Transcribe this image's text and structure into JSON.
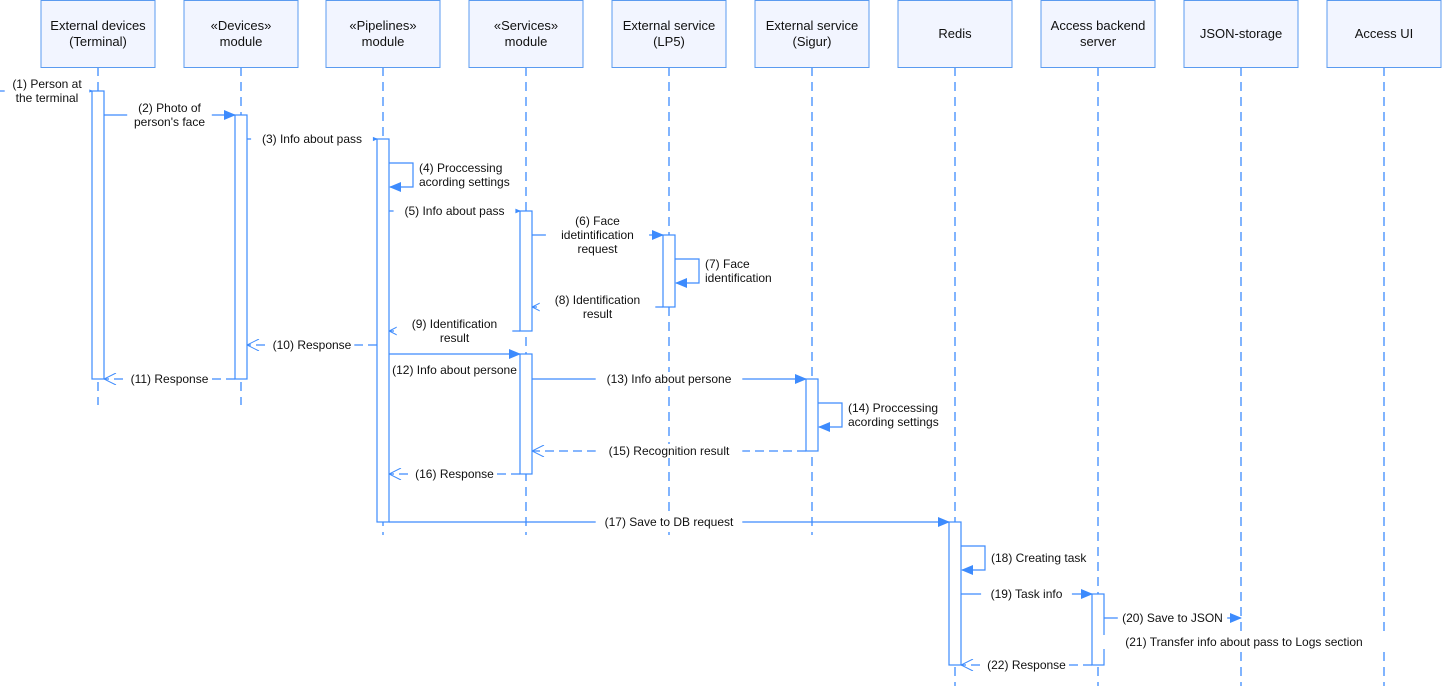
{
  "colors": {
    "line": "#3d8bfd",
    "box_fill": "#f2f5ff",
    "box_stroke": "#5b9bf0",
    "activation_fill": "#ffffff"
  },
  "participants": [
    [
      "External devices",
      "(Terminal)"
    ],
    [
      "«Devices»",
      "module"
    ],
    [
      "«Pipelines»",
      "module"
    ],
    [
      "«Services»",
      "module"
    ],
    [
      "External service",
      "(LP5)"
    ],
    [
      "External service",
      "(Sigur)"
    ],
    [
      "Redis"
    ],
    [
      "Access backend",
      "server"
    ],
    [
      "JSON-storage"
    ],
    [
      "Access UI"
    ]
  ],
  "messages": [
    {
      "from": -1,
      "to": 0,
      "type": "sync",
      "label": [
        "(1) Person at",
        "the terminal"
      ]
    },
    {
      "from": 0,
      "to": 1,
      "type": "sync",
      "label": [
        "(2) Photo of",
        "person's face"
      ]
    },
    {
      "from": 1,
      "to": 2,
      "type": "sync",
      "label": [
        "(3) Info about pass"
      ]
    },
    {
      "from": 2,
      "to": 2,
      "type": "self",
      "label": [
        "(4) Proccessing",
        "acording settings"
      ]
    },
    {
      "from": 2,
      "to": 3,
      "type": "sync",
      "label": [
        "(5) Info about pass"
      ]
    },
    {
      "from": 3,
      "to": 4,
      "type": "sync",
      "label": [
        "(6) Face",
        "idetintification",
        "request"
      ]
    },
    {
      "from": 4,
      "to": 4,
      "type": "self",
      "label": [
        "(7) Face",
        "identification"
      ]
    },
    {
      "from": 4,
      "to": 3,
      "type": "return",
      "label": [
        "(8) Identification",
        "result"
      ]
    },
    {
      "from": 3,
      "to": 2,
      "type": "return",
      "label": [
        "(9) Identification",
        "result"
      ]
    },
    {
      "from": 2,
      "to": 1,
      "type": "return",
      "label": [
        "(10) Response"
      ]
    },
    {
      "from": 1,
      "to": 0,
      "type": "return",
      "label": [
        "(11) Response"
      ]
    },
    {
      "from": 2,
      "to": 3,
      "type": "sync",
      "label": [
        "(12) Info about persone"
      ]
    },
    {
      "from": 3,
      "to": 5,
      "type": "sync",
      "label": [
        "(13) Info about persone"
      ]
    },
    {
      "from": 5,
      "to": 5,
      "type": "self",
      "label": [
        "(14) Proccessing",
        "acording settings"
      ]
    },
    {
      "from": 5,
      "to": 3,
      "type": "return",
      "label": [
        "(15) Recognition result"
      ]
    },
    {
      "from": 3,
      "to": 2,
      "type": "return",
      "label": [
        "(16) Response"
      ]
    },
    {
      "from": 2,
      "to": 6,
      "type": "sync",
      "label": [
        "(17) Save to DB request"
      ]
    },
    {
      "from": 6,
      "to": 6,
      "type": "self",
      "label": [
        "(18) Creating task"
      ]
    },
    {
      "from": 6,
      "to": 7,
      "type": "sync",
      "label": [
        "(19) Task info"
      ]
    },
    {
      "from": 7,
      "to": 8,
      "type": "sync",
      "label": [
        "(20) Save to JSON"
      ]
    },
    {
      "from": 7,
      "to": 9,
      "type": "sync",
      "label": [
        "(21) Transfer info about pass to Logs section"
      ]
    },
    {
      "from": 7,
      "to": 6,
      "type": "return",
      "label": [
        "(22) Response"
      ]
    }
  ]
}
